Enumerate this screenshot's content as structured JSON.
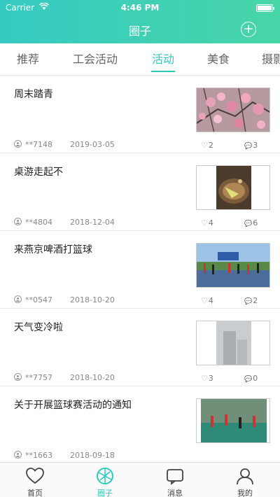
{
  "status_bar": {
    "carrier": "Carrier",
    "time": "4:46 PM"
  },
  "nav": {
    "title": "圈子",
    "add_icon": "plus-circle-icon"
  },
  "tabs": [
    {
      "label": "推荐",
      "active": false
    },
    {
      "label": "工会活动",
      "active": false
    },
    {
      "label": "活动",
      "active": true
    },
    {
      "label": "美食",
      "active": false
    },
    {
      "label": "摄影",
      "active": false
    }
  ],
  "posts": [
    {
      "title": "周末踏青",
      "user": "**7148",
      "date": "2019-03-05",
      "likes": "2",
      "comments": "3",
      "image": "pink-blossoms-photo"
    },
    {
      "title": "桌游走起不",
      "user": "**4804",
      "date": "2018-12-04",
      "likes": "4",
      "comments": "6",
      "image": "board-game-photo"
    },
    {
      "title": "来燕京啤酒打篮球",
      "user": "**0547",
      "date": "2018-10-20",
      "likes": "4",
      "comments": "2",
      "image": "basketball-court-photo"
    },
    {
      "title": "天气变冷啦",
      "user": "**7757",
      "date": "2018-10-20",
      "likes": "3",
      "comments": "0",
      "image": "foggy-building-photo"
    },
    {
      "title": "关于开展篮球赛活动的通知",
      "user": "**1663",
      "date": "2018-09-18",
      "likes": "",
      "comments": "",
      "image": "basketball-game-photo"
    }
  ],
  "tabbar": [
    {
      "label": "首页",
      "icon": "heart-outline-icon",
      "active": false
    },
    {
      "label": "圈子",
      "icon": "circle-icon",
      "active": true
    },
    {
      "label": "消息",
      "icon": "message-icon",
      "active": false
    },
    {
      "label": "我的",
      "icon": "profile-icon",
      "active": false
    }
  ],
  "colors": {
    "accent": "#2fc8c1",
    "header_start": "#35c9c2",
    "header_end": "#48d6a8"
  }
}
